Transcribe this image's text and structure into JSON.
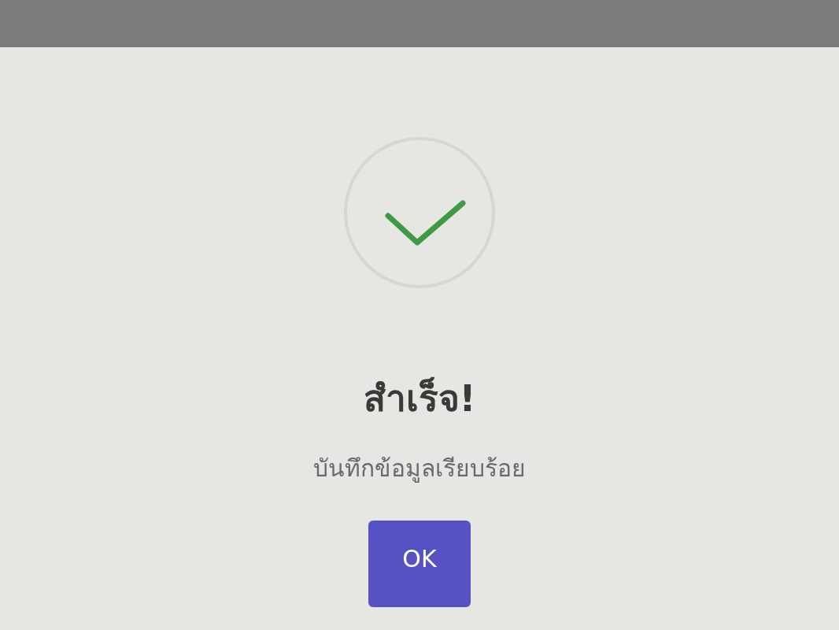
{
  "dialog": {
    "kind": "success",
    "title": "สำเร็จ!",
    "message": "บันทึกข้อมูลเรียบร้อย",
    "buttons": [
      "OK"
    ]
  }
}
